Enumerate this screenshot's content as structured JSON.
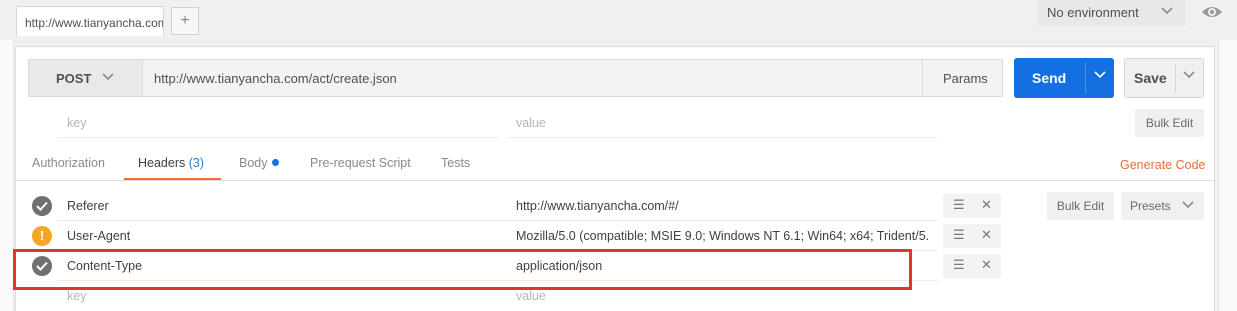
{
  "tab": {
    "label": "http://www.tianyancha.com"
  },
  "new_tab_icon": "plus-icon",
  "environment": {
    "selected": "No environment"
  },
  "request": {
    "method": "POST",
    "url": "http://www.tianyancha.com/act/create.json",
    "params_label": "Params",
    "send_label": "Send",
    "save_label": "Save"
  },
  "params_row": {
    "key_placeholder": "key",
    "value_placeholder": "value",
    "bulk_edit": "Bulk Edit"
  },
  "request_tabs": {
    "authorization": "Authorization",
    "headers": "Headers",
    "headers_count": "(3)",
    "body": "Body",
    "prerequest": "Pre-request Script",
    "tests": "Tests",
    "generate_code": "Generate Code"
  },
  "headers": [
    {
      "key": "Referer",
      "value": "http://www.tianyancha.com/#/",
      "status": "check"
    },
    {
      "key": "User-Agent",
      "value": "Mozilla/5.0 (compatible; MSIE 9.0; Windows NT 6.1; Win64; x64; Trident/5.",
      "status": "warning"
    },
    {
      "key": "Content-Type",
      "value": "application/json",
      "status": "check"
    }
  ],
  "new_header": {
    "key_placeholder": "key",
    "value_placeholder": "value"
  },
  "headers_actions": {
    "bulk_edit": "Bulk Edit",
    "presets": "Presets"
  },
  "colors": {
    "send": "#1470e0",
    "accent": "#f26b3a",
    "highlight": "#e03434",
    "warning": "#f5a623"
  }
}
